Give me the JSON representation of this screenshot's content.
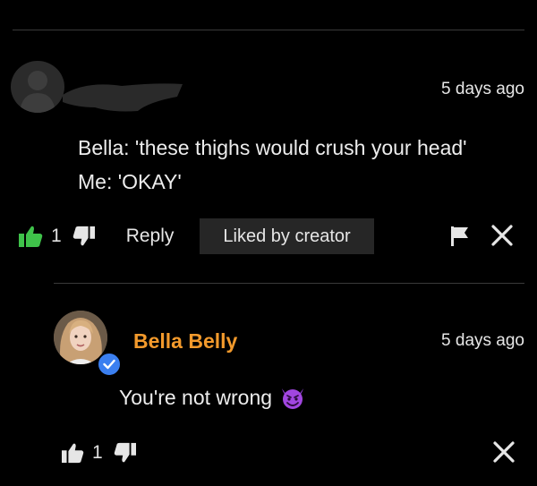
{
  "comment": {
    "time": "5 days ago",
    "lines": [
      "Bella: 'these thighs would crush your head'",
      "Me: 'OKAY'"
    ],
    "likes": "1",
    "reply_label": "Reply",
    "liked_badge": "Liked by creator"
  },
  "reply": {
    "author": "Bella Belly",
    "time": "5 days ago",
    "text": "You're not wrong",
    "likes": "1"
  },
  "icons": {
    "thumbs_up": "thumbs-up-icon",
    "thumbs_down": "thumbs-down-icon",
    "flag": "flag-icon",
    "close": "close-icon",
    "verified": "verified-check-icon",
    "emoji": "smiling-devil-emoji"
  },
  "colors": {
    "background": "#000000",
    "liked_green": "#3fc24a",
    "author_orange": "#f39a2c",
    "verified_blue": "#3b7ff0",
    "badge_bg": "#262626"
  }
}
